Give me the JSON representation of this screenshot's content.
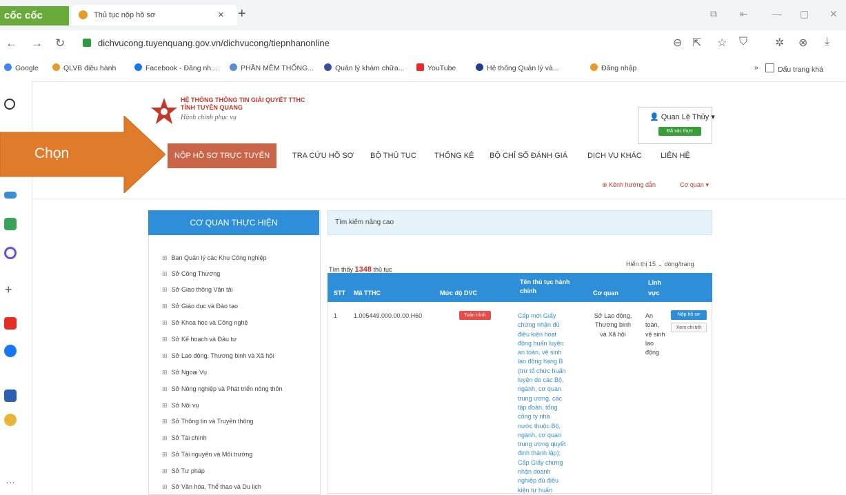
{
  "browser": {
    "brand": "cốc cốc",
    "tab_title": "Thủ tục nộp hồ sơ",
    "tab_close": "×",
    "new_tab": "+",
    "url": "dichvucong.tuyenquang.gov.vn/dichvucong/tiepnhanonline",
    "bookmarks": [
      "Google",
      "QLVB điều hành",
      "Facebook - Đăng nh...",
      "PHẦN MỀM THỐNG...",
      "Quản lý khám chữa...",
      "YouTube",
      "Hệ thống Quản lý và...",
      "Đăng nhập"
    ],
    "bookmarks_overflow": "»",
    "bookmarks_folder": "Dấu trang khá"
  },
  "header": {
    "system_name_line1": "HỆ THỐNG THÔNG TIN GIẢI QUYẾT TTHC",
    "system_name_line2": "TỈNH TUYÊN QUANG",
    "slogan": "Hành chính phục vụ",
    "user_name": "Quan Lệ Thủy",
    "user_status": "Đã xác thực"
  },
  "nav": {
    "items": [
      "NỘP HỒ SƠ TRỰC TUYẾN",
      "TRA CỨU HỒ SƠ",
      "BỘ THỦ TỤC",
      "THỐNG KÊ",
      "BỘ CHỈ SỐ ĐÁNH GIÁ",
      "DỊCH VỤ KHÁC",
      "LIÊN HỆ"
    ],
    "guide": "Kênh hướng dẫn",
    "agency": "Cơ quan"
  },
  "annotation": {
    "label": "Chọn"
  },
  "agency_panel": {
    "title": "CƠ QUAN THỰC HIỆN",
    "items": [
      "Ban Quản lý các Khu Công nghiệp",
      "Sở Công Thương",
      "Sở Giao thông Vận tải",
      "Sở Giáo dục và Đào tạo",
      "Sở Khoa học và Công nghệ",
      "Sở Kế hoạch và Đầu tư",
      "Sở Lao động, Thương binh và Xã hội",
      "Sở Ngoại Vụ",
      "Sở Nông nghiệp và Phát triển nông thôn",
      "Sở Nội vụ",
      "Sở Thông tin và Truyền thông",
      "Sở Tài chính",
      "Sở Tài nguyên và Môi trường",
      "Sở Tư pháp",
      "Sở Văn hóa, Thể thao và Du lịch"
    ]
  },
  "search": {
    "advanced": "Tìm kiếm nâng cao",
    "found_prefix": "Tìm thấy",
    "found_count": "1348",
    "found_suffix": "thủ tục",
    "show_label": "Hiển thị 15",
    "per_page": "dòng/trang"
  },
  "table": {
    "headers": [
      "STT",
      "Mã TTHC",
      "Mức độ DVC",
      "Tên thủ tục hành chính",
      "Cơ quan",
      "Lĩnh vực"
    ],
    "row": {
      "stt": "1",
      "code": "1.005449.000.00.00.H60",
      "level": "Toàn trình",
      "name": "Cấp mới Giấy chứng nhận đủ điều kiện hoạt động huấn luyện an toàn, vệ sinh lao động hạng B (trừ tổ chức huấn luyện do các Bộ, ngành, cơ quan trung ương, các tập đoàn, tổng công ty nhà nước thuộc Bộ, ngành, cơ quan trung ương quyết định thành lập); Cấp Giấy chứng nhận doanh nghiệp đủ điều kiện tự huấn",
      "agency": "Sở Lao động, Thương binh và Xã hội",
      "field": "An toàn, vệ sinh lao động",
      "submit": "Nộp hồ sơ",
      "detail": "Xem chi tiết"
    }
  }
}
